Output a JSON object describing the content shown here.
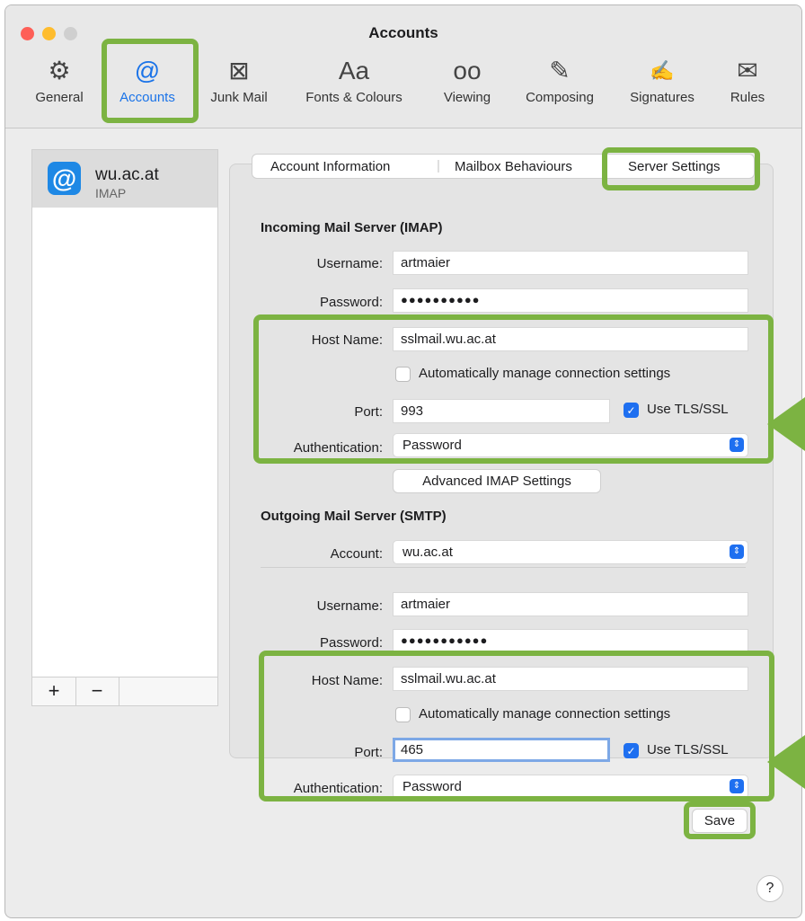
{
  "window": {
    "title": "Accounts"
  },
  "toolbar": [
    {
      "label": "General",
      "icon": "gear-icon"
    },
    {
      "label": "Accounts",
      "icon": "at-icon",
      "active": true
    },
    {
      "label": "Junk Mail",
      "icon": "junk-icon"
    },
    {
      "label": "Fonts & Colours",
      "icon": "font-icon"
    },
    {
      "label": "Viewing",
      "icon": "glasses-icon"
    },
    {
      "label": "Composing",
      "icon": "compose-icon"
    },
    {
      "label": "Signatures",
      "icon": "signature-icon"
    },
    {
      "label": "Rules",
      "icon": "rules-icon"
    }
  ],
  "sidebar": {
    "account": {
      "name": "wu.ac.at",
      "type": "IMAP"
    },
    "add_label": "+",
    "remove_label": "−"
  },
  "tabs": [
    "Account Information",
    "Mailbox Behaviours",
    "Server Settings"
  ],
  "incoming": {
    "header": "Incoming Mail Server (IMAP)",
    "username_label": "Username:",
    "username": "artmaier",
    "password_label": "Password:",
    "password": "●●●●●●●●●●",
    "host_label": "Host Name:",
    "host": "sslmail.wu.ac.at",
    "auto_label": "Automatically manage connection settings",
    "port_label": "Port:",
    "port": "993",
    "tls_label": "Use TLS/SSL",
    "auth_label": "Authentication:",
    "auth": "Password",
    "advanced": "Advanced IMAP Settings"
  },
  "outgoing": {
    "header": "Outgoing Mail Server (SMTP)",
    "account_label": "Account:",
    "account": "wu.ac.at",
    "username_label": "Username:",
    "username": "artmaier",
    "password_label": "Password:",
    "password": "●●●●●●●●●●●",
    "host_label": "Host Name:",
    "host": "sslmail.wu.ac.at",
    "auto_label": "Automatically manage connection settings",
    "port_label": "Port:",
    "port": "465",
    "tls_label": "Use TLS/SSL",
    "auth_label": "Authentication:",
    "auth": "Password"
  },
  "save": "Save",
  "help": "?",
  "colors": {
    "accent": "#1e6ff0",
    "highlight": "#7cb342"
  }
}
